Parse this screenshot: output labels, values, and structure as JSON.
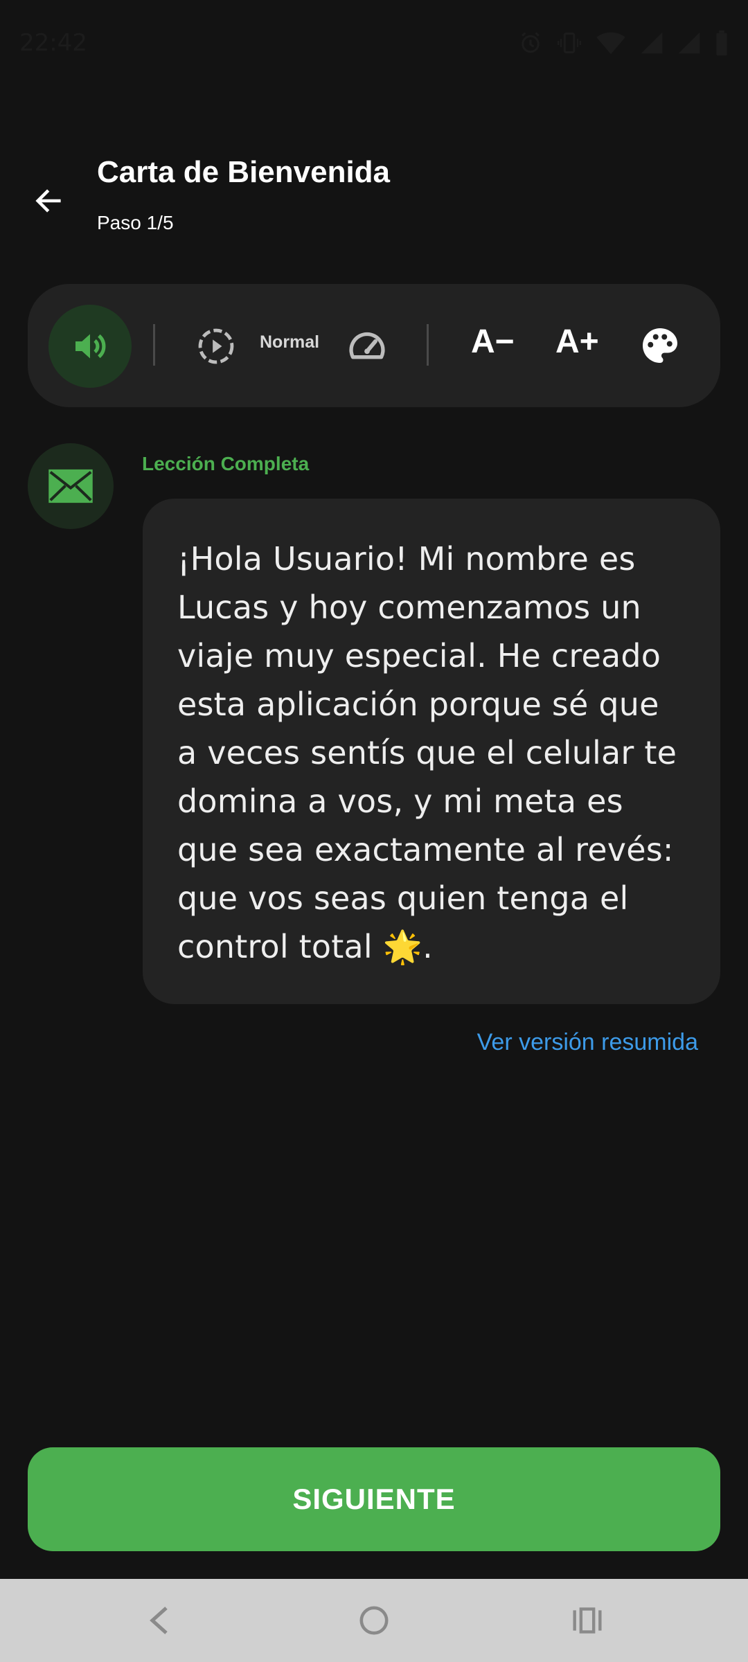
{
  "status_bar": {
    "time": "22:42",
    "icons": [
      "alarm-icon",
      "vibrate-icon",
      "wifi-icon",
      "signal-icon",
      "signal-icon",
      "battery-icon"
    ]
  },
  "header": {
    "title": "Carta de Bienvenida",
    "subtitle": "Paso 1/5",
    "back_icon": "arrow-left-icon"
  },
  "toolbar": {
    "audio_icon": "speaker-icon",
    "replay_icon": "replay-dashed-icon",
    "speed_label": "Normal",
    "speed_icon": "speedometer-icon",
    "font_decrease": "A−",
    "font_increase": "A+",
    "theme_icon": "palette-icon"
  },
  "lesson": {
    "icon": "envelope-icon",
    "status": "Lección Completa",
    "message": "¡Hola Usuario! Mi nombre es Lucas y hoy comenzamos un viaje muy especial. He creado esta aplicación porque sé que a veces sentís que el celular te domina a vos, y mi meta es que sea exactamente al revés: que vos seas quien tenga el control total 🌟.",
    "summary_link": "Ver versión resumida"
  },
  "next_button": {
    "label": "SIGUIENTE"
  },
  "colors": {
    "background": "#131313",
    "accent_green": "#4caf50",
    "link_blue": "#3d9be9",
    "card": "#232323"
  },
  "nav_bar": {
    "back_icon": "nav-back-icon",
    "home_icon": "nav-home-icon",
    "recents_icon": "nav-recents-icon"
  }
}
